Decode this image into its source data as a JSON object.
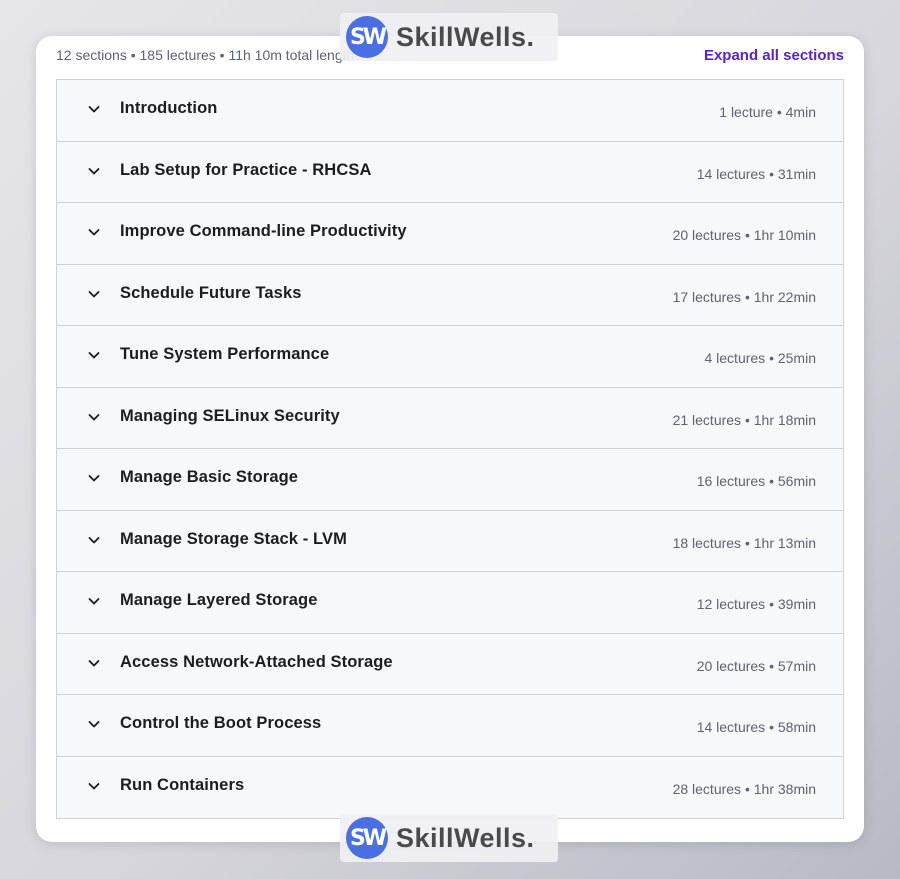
{
  "summary": {
    "text": "12 sections • 185 lectures • 11h 10m total length",
    "expand_label": "Expand all sections"
  },
  "sections": [
    {
      "title": "Introduction",
      "meta": "1 lecture • 4min"
    },
    {
      "title": "Lab Setup for Practice - RHCSA",
      "meta": "14 lectures • 31min"
    },
    {
      "title": "Improve Command-line Productivity",
      "meta": "20 lectures • 1hr 10min"
    },
    {
      "title": "Schedule Future Tasks",
      "meta": "17 lectures • 1hr 22min"
    },
    {
      "title": "Tune System Performance",
      "meta": "4 lectures • 25min"
    },
    {
      "title": "Managing SELinux Security",
      "meta": "21 lectures • 1hr 18min"
    },
    {
      "title": "Manage Basic Storage",
      "meta": "16 lectures • 56min"
    },
    {
      "title": "Manage Storage Stack - LVM",
      "meta": "18 lectures • 1hr 13min"
    },
    {
      "title": "Manage Layered Storage",
      "meta": "12 lectures • 39min"
    },
    {
      "title": "Access Network-Attached Storage",
      "meta": "20 lectures • 57min"
    },
    {
      "title": "Control the Boot Process",
      "meta": "14 lectures • 58min"
    },
    {
      "title": "Run Containers",
      "meta": "28 lectures • 1hr 38min"
    }
  ],
  "watermark": {
    "logo_text": "SW",
    "brand": "SkillWells."
  },
  "colors": {
    "accent": "#5624d0",
    "row_bg": "#f7f8fa",
    "border": "#d1d2d6",
    "watermark_logo": "#4a6fe0"
  }
}
